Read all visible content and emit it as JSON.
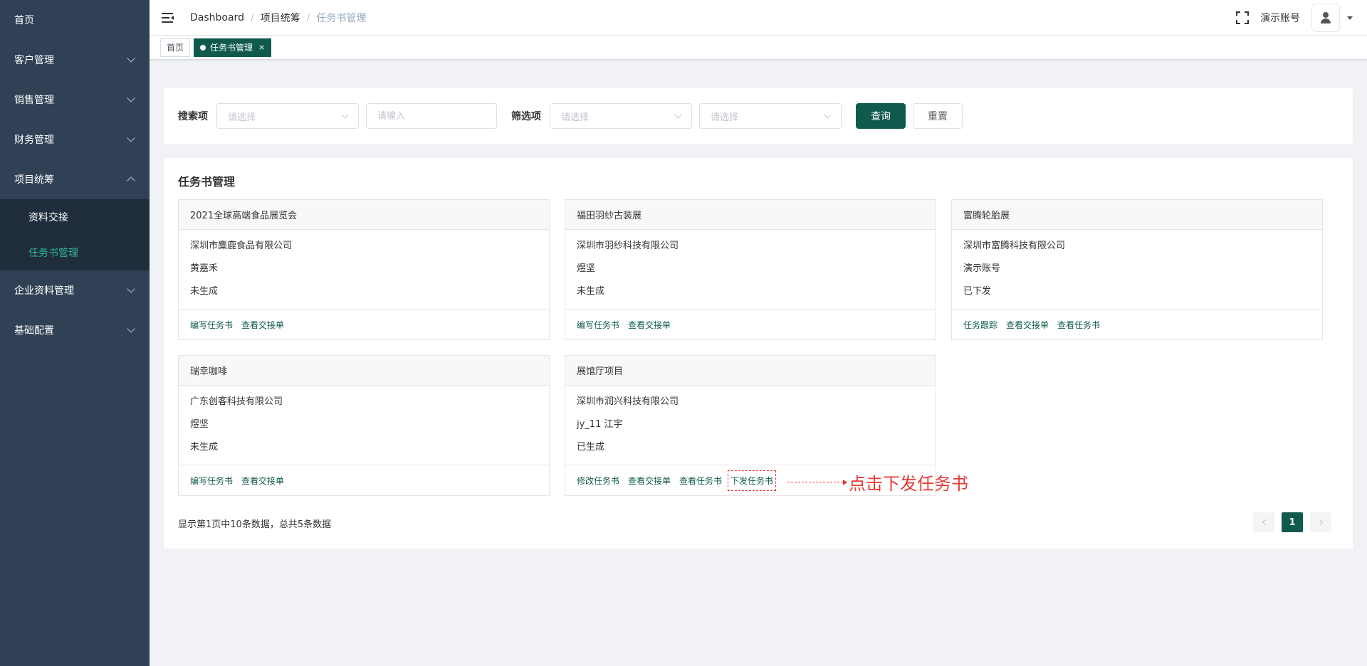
{
  "sidebar": {
    "items": [
      {
        "label": "首页",
        "has_children": false
      },
      {
        "label": "客户管理",
        "has_children": true
      },
      {
        "label": "销售管理",
        "has_children": true
      },
      {
        "label": "财务管理",
        "has_children": true
      },
      {
        "label": "项目统筹",
        "has_children": true,
        "expanded": true
      },
      {
        "label": "企业资料管理",
        "has_children": true
      },
      {
        "label": "基础配置",
        "has_children": true
      }
    ],
    "sub_items": [
      {
        "label": "资料交接",
        "active": false
      },
      {
        "label": "任务书管理",
        "active": true
      }
    ]
  },
  "header": {
    "breadcrumb": [
      "Dashboard",
      "项目统筹",
      "任务书管理"
    ],
    "username": "演示账号",
    "icons": [
      "hamburger-icon",
      "fullscreen-icon",
      "user-icon",
      "caret-down-icon"
    ]
  },
  "tags": [
    {
      "label": "首页",
      "active": false
    },
    {
      "label": "任务书管理",
      "active": true,
      "close": "×"
    }
  ],
  "search": {
    "search_label": "搜索项",
    "select1_placeholder": "请选择",
    "input_placeholder": "请输入",
    "filter_label": "筛选项",
    "select2_placeholder": "请选择",
    "select3_placeholder": "请选择",
    "query_label": "查询",
    "reset_label": "重置"
  },
  "panel": {
    "title": "任务书管理",
    "cards": [
      {
        "title": "2021全球高端食品展览会",
        "company": "深圳市麋鹿食品有限公司",
        "person": "黄嘉禾",
        "status": "未生成",
        "actions": [
          "编写任务书",
          "查看交接单"
        ]
      },
      {
        "title": "福田羽纱古装展",
        "company": "深圳市羽纱科技有限公司",
        "person": "煜坚",
        "status": "未生成",
        "actions": [
          "编写任务书",
          "查看交接单"
        ]
      },
      {
        "title": "富腾轮胎展",
        "company": "深圳市富腾科技有限公司",
        "person": "演示账号",
        "status": "已下发",
        "actions": [
          "任务跟踪",
          "查看交接单",
          "查看任务书"
        ]
      },
      {
        "title": "瑞幸咖啡",
        "company": "广东创客科技有限公司",
        "person": "煜坚",
        "status": "未生成",
        "actions": [
          "编写任务书",
          "查看交接单"
        ]
      },
      {
        "title": "展馆厅项目",
        "company": "深圳市润兴科技有限公司",
        "person": "jy_11 江宇",
        "status": "已生成",
        "actions": [
          "修改任务书",
          "查看交接单",
          "查看任务书",
          "下发任务书"
        ]
      }
    ],
    "annotation": "点击下发任务书",
    "pager_info": "显示第1页中10条数据，总共5条数据",
    "current_page": "1"
  },
  "colors": {
    "sidebar_bg": "#304156",
    "submenu_bg": "#1f2d3d",
    "accent": "#0f5a4c",
    "active_sub": "#2fb59a",
    "annotation": "#e53935"
  }
}
